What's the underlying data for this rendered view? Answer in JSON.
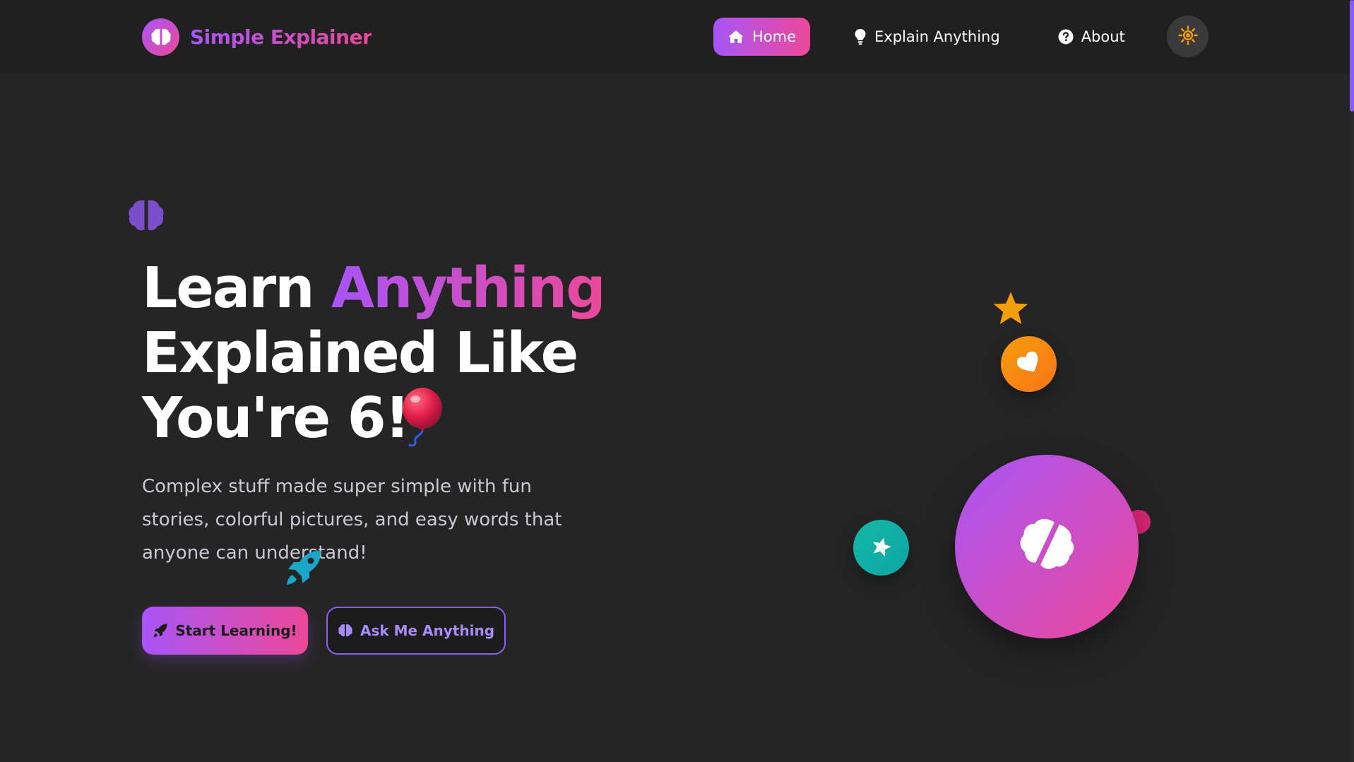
{
  "brand": {
    "name": "Simple Explainer",
    "logo_icon": "brain-icon"
  },
  "nav": {
    "items": [
      {
        "label": "Home",
        "icon": "home-icon",
        "active": true
      },
      {
        "label": "Explain Anything",
        "icon": "lightbulb-icon",
        "active": false
      },
      {
        "label": "About",
        "icon": "question-circle-icon",
        "active": false
      }
    ],
    "theme_toggle_icon": "sun-icon"
  },
  "hero": {
    "title_part1": "Learn",
    "title_highlight": "Anything",
    "title_line2": "Explained Like",
    "title_line3": "You're 6!",
    "subtitle": "Complex stuff made super simple with fun stories, colorful pictures, and easy words that anyone can understand!",
    "primary_button": "Start Learning!",
    "secondary_button": "Ask Me Anything"
  },
  "colors": {
    "accent_start": "#a855f7",
    "accent_end": "#ec4899",
    "background": "#252525",
    "navbar": "#202020",
    "sun": "#f59e0b",
    "teal": "#14b8a6",
    "orange": "#f97316"
  }
}
